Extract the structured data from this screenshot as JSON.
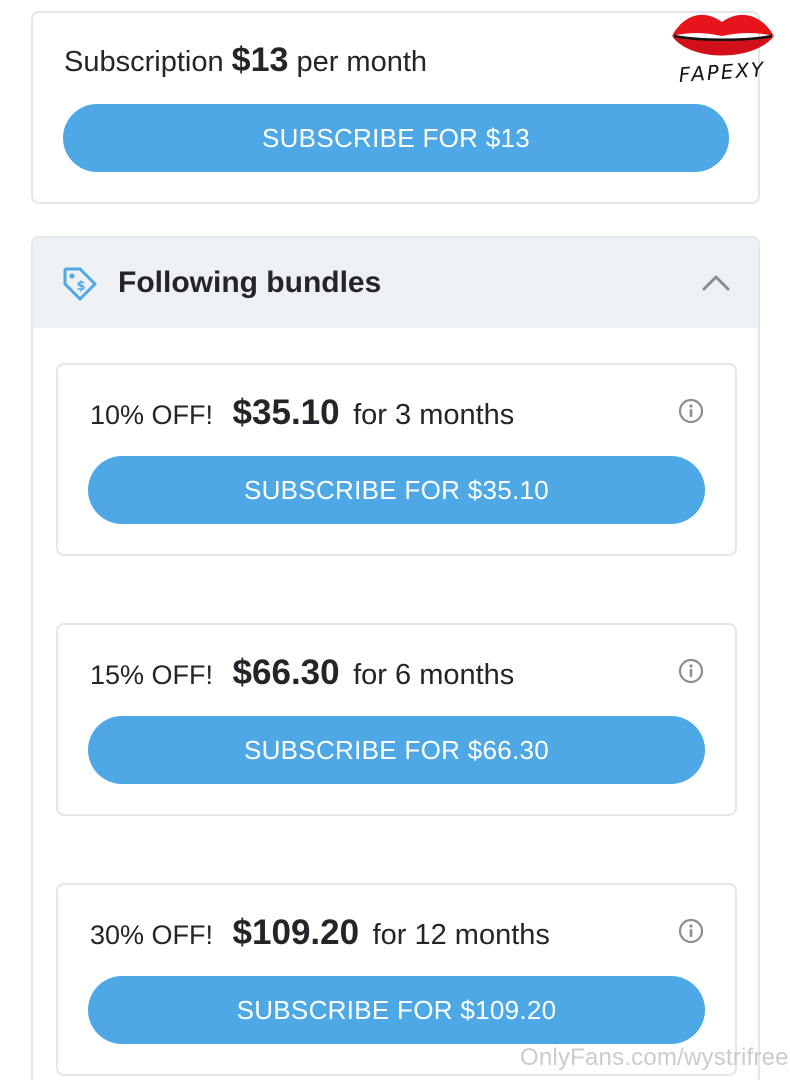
{
  "subscription": {
    "prefix": "Subscription",
    "price": "$13",
    "suffix": "per month",
    "button_label": "SUBSCRIBE FOR $13"
  },
  "logo": {
    "text": "FAPEXY",
    "icon": "lips-icon"
  },
  "bundles": {
    "title": "Following bundles",
    "icon": "price-tag-icon",
    "toggle_icon": "chevron-up-icon",
    "items": [
      {
        "discount": "10% OFF!",
        "price": "$35.10",
        "duration": "for 3 months",
        "button_label": "SUBSCRIBE FOR $35.10"
      },
      {
        "discount": "15% OFF!",
        "price": "$66.30",
        "duration": "for 6 months",
        "button_label": "SUBSCRIBE FOR $66.30"
      },
      {
        "discount": "30% OFF!",
        "price": "$109.20",
        "duration": "for 12 months",
        "button_label": "SUBSCRIBE FOR $109.20"
      }
    ]
  },
  "watermark": "OnlyFans.com/wystrifree",
  "colors": {
    "accent": "#4ea8e6",
    "header_bg": "#eef1f3",
    "border": "#e4e6e8",
    "text": "#242529",
    "logo_red": "#e8141c"
  }
}
